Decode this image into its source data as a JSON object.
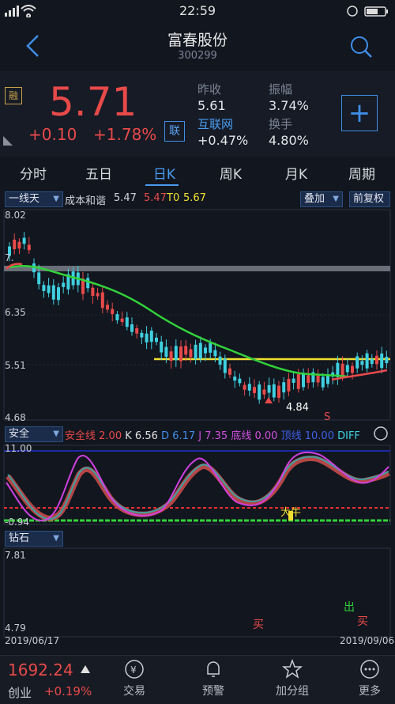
{
  "status": {
    "time": "22:59"
  },
  "header": {
    "title": "富春股份",
    "code": "300299"
  },
  "quote": {
    "badge": "融",
    "price": "5.71",
    "change": "+0.10",
    "change_pct": "+1.78%",
    "lian": "联",
    "prev_close_label": "昨收",
    "prev_close": "5.61",
    "amplitude_label": "振幅",
    "amplitude": "3.74%",
    "internet_label": "互联网",
    "internet": "+0.47%",
    "turnover_label": "换手",
    "turnover": "4.80%",
    "add": "+"
  },
  "tabs": [
    "分时",
    "五日",
    "日K",
    "周K",
    "月K",
    "周期"
  ],
  "kline": {
    "selector": "一线天",
    "indicator": "成本和谐",
    "v1": "5.47",
    "v2": "5.47",
    "t0": "T0",
    "v3": "5.67",
    "overlay": "叠加",
    "fq": "前复权",
    "y_top": "8.02",
    "y_mid1": "6.35",
    "y_mid2": "5.51",
    "y_bot": "4.68",
    "y_left_top": "7.",
    "low_label": "4.84",
    "s_label": "S"
  },
  "panel2": {
    "selector": "安全",
    "a_label": "安全线",
    "a_val": "2.00",
    "k_label": "K",
    "k_val": "6.56",
    "d_label": "D",
    "d_val": "6.17",
    "j_label": "J",
    "j_val": "7.35",
    "b_label": "底线",
    "b_val": "0.00",
    "t_label": "顶线",
    "t_val": "10.00",
    "diff": "DIFF",
    "y_top": "11.00",
    "y_bot": "-0.94",
    "annot": "大牛"
  },
  "panel3": {
    "selector": "钻石",
    "y_top": "7.81",
    "y_bot": "4.79",
    "buy1": "买",
    "out": "出",
    "buy2": "买",
    "date_start": "2019/06/17",
    "date_end": "2019/09/06"
  },
  "footer": {
    "index_value": "1692.24",
    "index_name": "创业",
    "index_pct": "+0.19%",
    "nav": [
      "交易",
      "预警",
      "加分组",
      "更多"
    ]
  },
  "colors": {
    "up": "#e84a4a",
    "down": "#3fd0e0",
    "accent": "#4a9cf0",
    "ma": "#32d23a",
    "cost": "#f0e030"
  }
}
